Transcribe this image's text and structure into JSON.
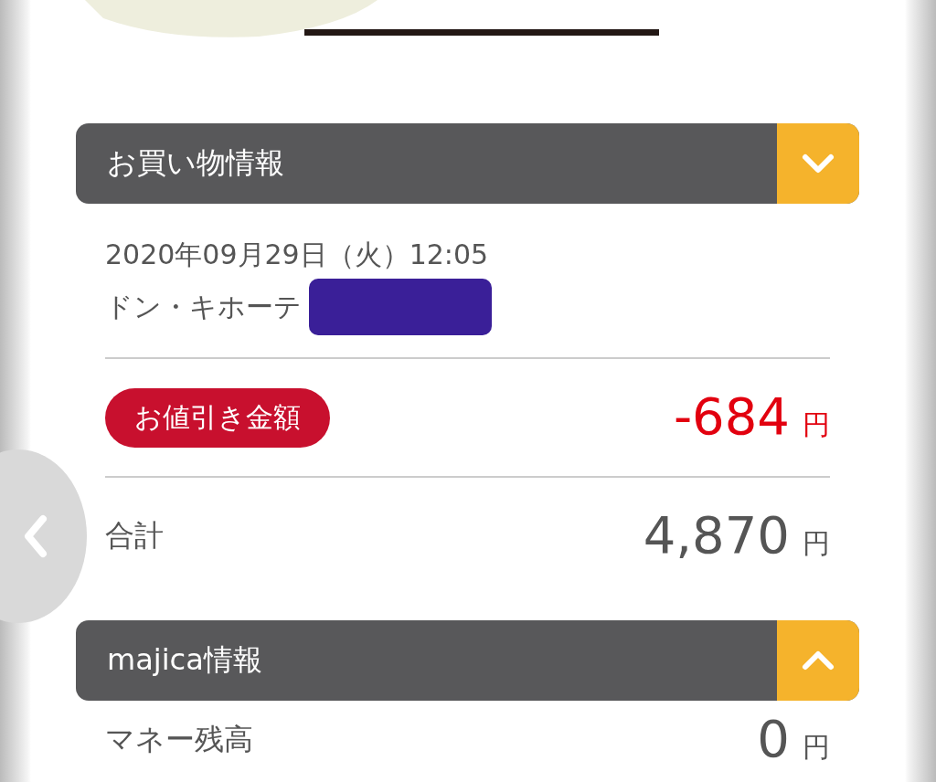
{
  "shopping": {
    "title": "お買い物情報",
    "expanded": false,
    "date": "2020年09月29日（火）12:05",
    "store": "ドン・キホーテ",
    "discount": {
      "label": "お値引き金額",
      "amount": "-684",
      "unit": "円"
    },
    "total": {
      "label": "合計",
      "amount": "4,870",
      "unit": "円"
    }
  },
  "majica": {
    "title": "majica情報",
    "expanded": true,
    "rows": [
      {
        "label": "マネー残高",
        "amount": "0",
        "unit": "円"
      }
    ]
  }
}
